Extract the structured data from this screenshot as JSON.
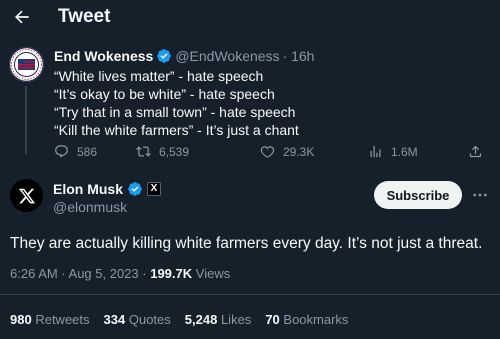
{
  "header": {
    "title": "Tweet"
  },
  "parent_tweet": {
    "display_name": "End Wokeness",
    "handle": "@EndWokeness",
    "time": "· 16h",
    "lines": [
      "“White lives matter” - hate speech",
      "“It’s okay to be white” - hate speech",
      "“Try that in a small town” - hate speech",
      "“Kill the white farmers” - It’s just a chant"
    ],
    "actions": {
      "replies": "586",
      "retweets": "6,539",
      "likes": "29.3K",
      "views": "1.6M"
    }
  },
  "main_tweet": {
    "display_name": "Elon Musk",
    "handle": "@elonmusk",
    "affiliate_badge": "X",
    "subscribe_label": "Subscribe",
    "text": "They are actually killing white farmers every day. It’s not just a threat.",
    "timestamp": "6:26 AM · Aug 5, 2023 ·",
    "views_count": "199.7K",
    "views_label": "Views",
    "stats": {
      "retweets_count": "980",
      "retweets_label": "Retweets",
      "quotes_count": "334",
      "quotes_label": "Quotes",
      "likes_count": "5,248",
      "likes_label": "Likes",
      "bookmarks_count": "70",
      "bookmarks_label": "Bookmarks"
    }
  },
  "colors": {
    "background": "#15202b",
    "text": "#f7f9f9",
    "muted": "#8b98a5",
    "verified": "#1d9bf0",
    "divider": "#38444d"
  }
}
